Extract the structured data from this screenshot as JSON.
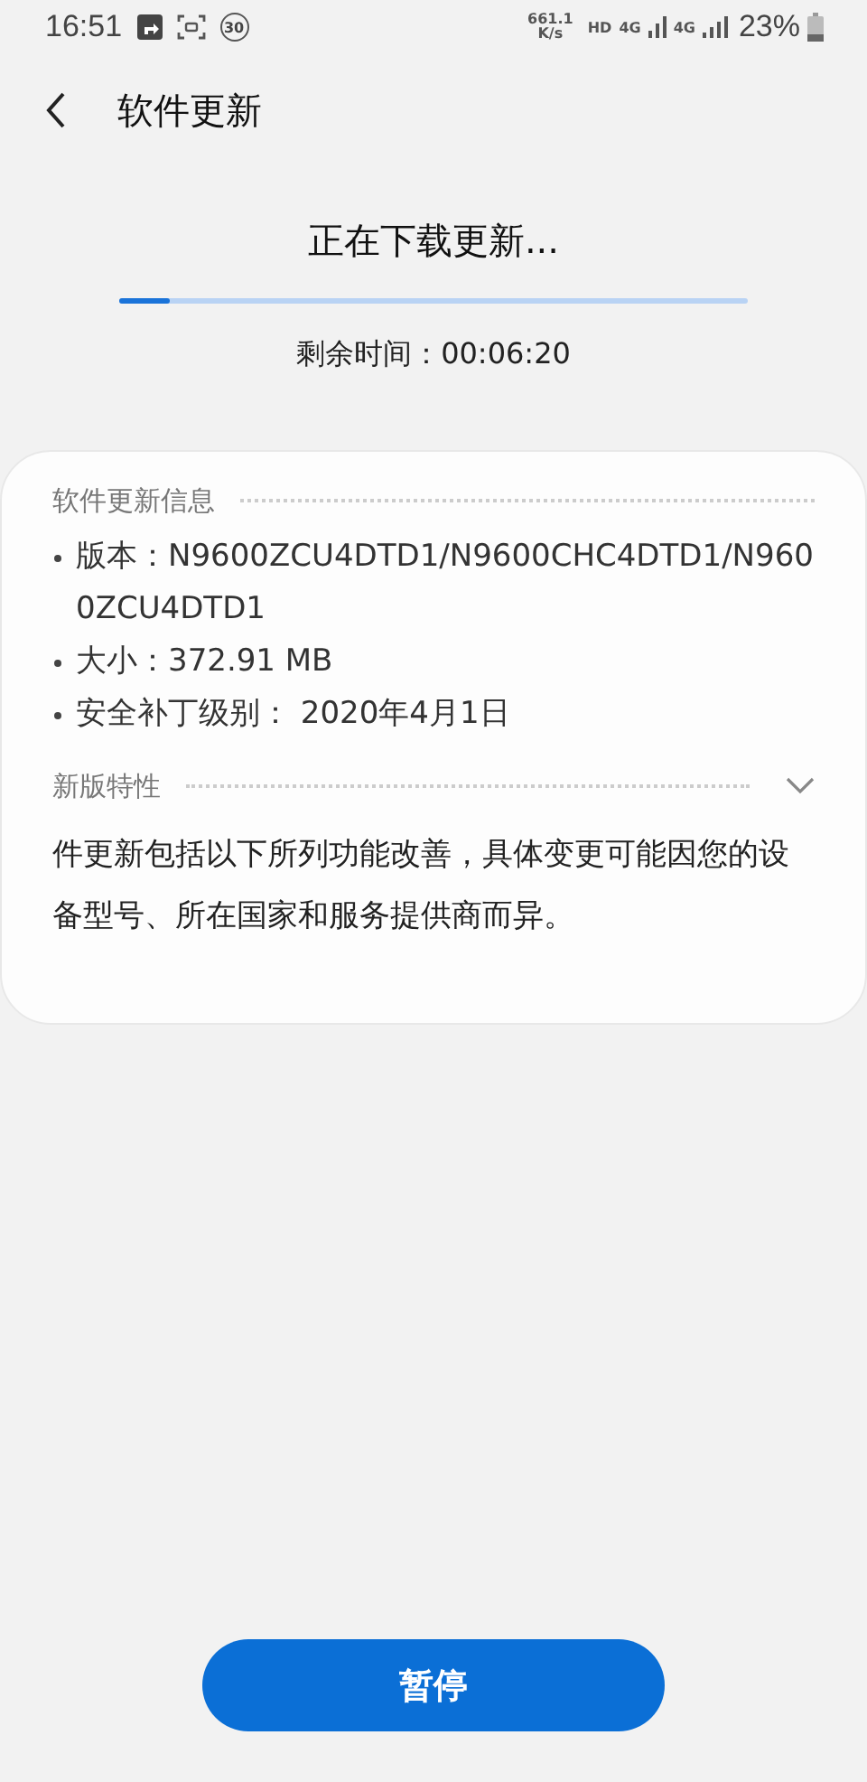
{
  "status_bar": {
    "time": "16:51",
    "badge": "30",
    "speed_value": "661.1",
    "speed_unit": "K/s",
    "hd": "HD",
    "network_1": "4G",
    "network_2": "4G",
    "battery": "23%"
  },
  "header": {
    "title": "软件更新"
  },
  "download": {
    "title": "正在下载更新...",
    "level": 0.08,
    "remaining": "剩余时间：00:06:20"
  },
  "info": {
    "title": "软件更新信息",
    "items": [
      {
        "text": "版本：N9600ZCU4DTD1/N9600CHC4DTD1/N9600ZCU4DTD1"
      },
      {
        "text": "大小：372.91 MB"
      },
      {
        "text": "安全补丁级别： 2020年4月1日"
      }
    ]
  },
  "features": {
    "title": "新版特性",
    "expanded": false,
    "text": "件更新包括以下所列功能改善，具体变更可能因您的设备型号、所在国家和服务提供商而异。"
  },
  "button": {
    "label": "暂停"
  }
}
